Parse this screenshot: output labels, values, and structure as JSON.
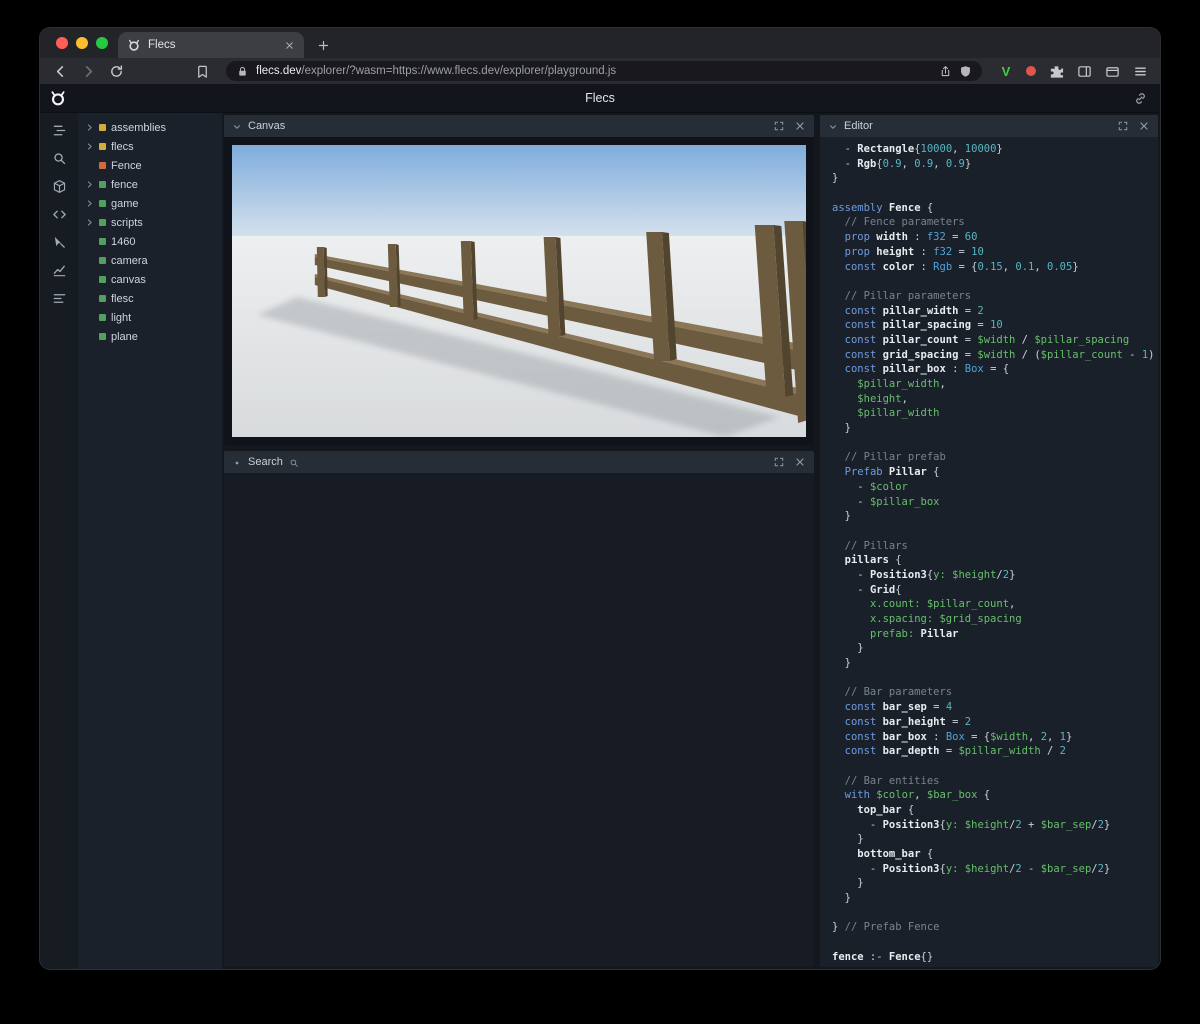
{
  "colors": {
    "traffic_red": "#ff5f57",
    "traffic_yellow": "#febc2e",
    "traffic_green": "#28c840",
    "accent_green_v": "#3dd13d",
    "badge_red": "#e1554a"
  },
  "browser": {
    "tab": {
      "title": "Flecs"
    },
    "toolbar": {
      "url_domain": "flecs.dev",
      "url_rest": "/explorer/?wasm=https://www.flecs.dev/explorer/playground.js",
      "v_badge": "V"
    }
  },
  "app": {
    "header": {
      "title": "Flecs"
    },
    "sidebar_icons": [
      {
        "name": "outliner-icon"
      },
      {
        "name": "search-icon"
      },
      {
        "name": "entities-icon"
      },
      {
        "name": "code-icon"
      },
      {
        "name": "inspect-icon"
      },
      {
        "name": "stats-icon"
      },
      {
        "name": "queries-icon"
      }
    ],
    "tree": {
      "items": [
        {
          "label": "assemblies",
          "color": "#cfae3d",
          "arrow": true
        },
        {
          "label": "flecs",
          "color": "#cfae3d",
          "arrow": true
        },
        {
          "label": "Fence",
          "color": "#d0693b",
          "arrow": false
        },
        {
          "label": "fence",
          "color": "#53a05e",
          "arrow": true
        },
        {
          "label": "game",
          "color": "#53a05e",
          "arrow": true
        },
        {
          "label": "scripts",
          "color": "#53a05e",
          "arrow": true
        },
        {
          "label": "1460",
          "color": "#53a05e",
          "arrow": false
        },
        {
          "label": "camera",
          "color": "#53a05e",
          "arrow": false
        },
        {
          "label": "canvas",
          "color": "#53a05e",
          "arrow": false
        },
        {
          "label": "flesc",
          "color": "#53a05e",
          "arrow": false
        },
        {
          "label": "light",
          "color": "#53a05e",
          "arrow": false
        },
        {
          "label": "plane",
          "color": "#53a05e",
          "arrow": false
        }
      ]
    },
    "panels": {
      "canvas": {
        "title": "Canvas"
      },
      "search": {
        "title": "Search"
      },
      "editor": {
        "title": "Editor"
      }
    }
  },
  "scene": {
    "description": "3D viewport showing a brown wooden fence with pillars and two rails on light ground under a blue sky",
    "sky_top": "#7facdc",
    "sky_bottom": "#d9e4ee",
    "ground_top": "#edeff0",
    "ground_bottom": "#d8dbdd",
    "wood_front": "#6d5b3f",
    "wood_top": "#8b7757",
    "wood_side": "#52452f",
    "shadow": "#9aa0a6"
  },
  "editor": {
    "palette": {
      "p": "#ccd2da",
      "k": "#6e9ce0",
      "t": "#4fa3d8",
      "n": "#56b6c2",
      "v": "#67bf6b",
      "c": "#79828e",
      "d": "#e8ebf0"
    },
    "lines": [
      [
        [
          "p",
          "  - "
        ],
        [
          "d",
          "Rectangle"
        ],
        [
          "p",
          "{"
        ],
        [
          "n",
          "10000"
        ],
        [
          "p",
          ", "
        ],
        [
          "n",
          "10000"
        ],
        [
          "p",
          "}"
        ]
      ],
      [
        [
          "p",
          "  - "
        ],
        [
          "d",
          "Rgb"
        ],
        [
          "p",
          "{"
        ],
        [
          "n",
          "0.9"
        ],
        [
          "p",
          ", "
        ],
        [
          "n",
          "0.9"
        ],
        [
          "p",
          ", "
        ],
        [
          "n",
          "0.9"
        ],
        [
          "p",
          "}"
        ]
      ],
      [
        [
          "p",
          "}"
        ]
      ],
      [],
      [
        [
          "k",
          "assembly"
        ],
        [
          "p",
          " "
        ],
        [
          "d",
          "Fence"
        ],
        [
          "p",
          " {"
        ]
      ],
      [
        [
          "c",
          "  // Fence parameters"
        ]
      ],
      [
        [
          "p",
          "  "
        ],
        [
          "k",
          "prop"
        ],
        [
          "p",
          " "
        ],
        [
          "d",
          "width"
        ],
        [
          "p",
          " : "
        ],
        [
          "t",
          "f32"
        ],
        [
          "p",
          " = "
        ],
        [
          "n",
          "60"
        ]
      ],
      [
        [
          "p",
          "  "
        ],
        [
          "k",
          "prop"
        ],
        [
          "p",
          " "
        ],
        [
          "d",
          "height"
        ],
        [
          "p",
          " : "
        ],
        [
          "t",
          "f32"
        ],
        [
          "p",
          " = "
        ],
        [
          "n",
          "10"
        ]
      ],
      [
        [
          "p",
          "  "
        ],
        [
          "k",
          "const"
        ],
        [
          "p",
          " "
        ],
        [
          "d",
          "color"
        ],
        [
          "p",
          " : "
        ],
        [
          "t",
          "Rgb"
        ],
        [
          "p",
          " = {"
        ],
        [
          "n",
          "0.15"
        ],
        [
          "p",
          ", "
        ],
        [
          "n",
          "0.1"
        ],
        [
          "p",
          ", "
        ],
        [
          "n",
          "0.05"
        ],
        [
          "p",
          "}"
        ]
      ],
      [],
      [
        [
          "c",
          "  // Pillar parameters"
        ]
      ],
      [
        [
          "p",
          "  "
        ],
        [
          "k",
          "const"
        ],
        [
          "p",
          " "
        ],
        [
          "d",
          "pillar_width"
        ],
        [
          "p",
          " = "
        ],
        [
          "n",
          "2"
        ]
      ],
      [
        [
          "p",
          "  "
        ],
        [
          "k",
          "const"
        ],
        [
          "p",
          " "
        ],
        [
          "d",
          "pillar_spacing"
        ],
        [
          "p",
          " = "
        ],
        [
          "n",
          "10"
        ]
      ],
      [
        [
          "p",
          "  "
        ],
        [
          "k",
          "const"
        ],
        [
          "p",
          " "
        ],
        [
          "d",
          "pillar_count"
        ],
        [
          "p",
          " = "
        ],
        [
          "v",
          "$width"
        ],
        [
          "p",
          " / "
        ],
        [
          "v",
          "$pillar_spacing"
        ]
      ],
      [
        [
          "p",
          "  "
        ],
        [
          "k",
          "const"
        ],
        [
          "p",
          " "
        ],
        [
          "d",
          "grid_spacing"
        ],
        [
          "p",
          " = "
        ],
        [
          "v",
          "$width"
        ],
        [
          "p",
          " / ("
        ],
        [
          "v",
          "$pillar_count"
        ],
        [
          "p",
          " - "
        ],
        [
          "n",
          "1"
        ],
        [
          "p",
          ")"
        ]
      ],
      [
        [
          "p",
          "  "
        ],
        [
          "k",
          "const"
        ],
        [
          "p",
          " "
        ],
        [
          "d",
          "pillar_box"
        ],
        [
          "p",
          " : "
        ],
        [
          "t",
          "Box"
        ],
        [
          "p",
          " = {"
        ]
      ],
      [
        [
          "p",
          "    "
        ],
        [
          "v",
          "$pillar_width"
        ],
        [
          "p",
          ","
        ]
      ],
      [
        [
          "p",
          "    "
        ],
        [
          "v",
          "$height"
        ],
        [
          "p",
          ","
        ]
      ],
      [
        [
          "p",
          "    "
        ],
        [
          "v",
          "$pillar_width"
        ]
      ],
      [
        [
          "p",
          "  }"
        ]
      ],
      [],
      [
        [
          "c",
          "  // Pillar prefab"
        ]
      ],
      [
        [
          "p",
          "  "
        ],
        [
          "k",
          "Prefab"
        ],
        [
          "p",
          " "
        ],
        [
          "d",
          "Pillar"
        ],
        [
          "p",
          " {"
        ]
      ],
      [
        [
          "p",
          "    - "
        ],
        [
          "v",
          "$color"
        ]
      ],
      [
        [
          "p",
          "    - "
        ],
        [
          "v",
          "$pillar_box"
        ]
      ],
      [
        [
          "p",
          "  }"
        ]
      ],
      [],
      [
        [
          "c",
          "  // Pillars"
        ]
      ],
      [
        [
          "p",
          "  "
        ],
        [
          "d",
          "pillars"
        ],
        [
          "p",
          " {"
        ]
      ],
      [
        [
          "p",
          "    - "
        ],
        [
          "d",
          "Position3"
        ],
        [
          "p",
          "{"
        ],
        [
          "v",
          "y:"
        ],
        [
          "p",
          " "
        ],
        [
          "v",
          "$height"
        ],
        [
          "p",
          "/"
        ],
        [
          "n",
          "2"
        ],
        [
          "p",
          "}"
        ]
      ],
      [
        [
          "p",
          "    - "
        ],
        [
          "d",
          "Grid"
        ],
        [
          "p",
          "{"
        ]
      ],
      [
        [
          "p",
          "      "
        ],
        [
          "v",
          "x.count:"
        ],
        [
          "p",
          " "
        ],
        [
          "v",
          "$pillar_count"
        ],
        [
          "p",
          ","
        ]
      ],
      [
        [
          "p",
          "      "
        ],
        [
          "v",
          "x.spacing:"
        ],
        [
          "p",
          " "
        ],
        [
          "v",
          "$grid_spacing"
        ]
      ],
      [
        [
          "p",
          "      "
        ],
        [
          "v",
          "prefab:"
        ],
        [
          "p",
          " "
        ],
        [
          "d",
          "Pillar"
        ]
      ],
      [
        [
          "p",
          "    }"
        ]
      ],
      [
        [
          "p",
          "  }"
        ]
      ],
      [],
      [
        [
          "c",
          "  // Bar parameters"
        ]
      ],
      [
        [
          "p",
          "  "
        ],
        [
          "k",
          "const"
        ],
        [
          "p",
          " "
        ],
        [
          "d",
          "bar_sep"
        ],
        [
          "p",
          " = "
        ],
        [
          "n",
          "4"
        ]
      ],
      [
        [
          "p",
          "  "
        ],
        [
          "k",
          "const"
        ],
        [
          "p",
          " "
        ],
        [
          "d",
          "bar_height"
        ],
        [
          "p",
          " = "
        ],
        [
          "n",
          "2"
        ]
      ],
      [
        [
          "p",
          "  "
        ],
        [
          "k",
          "const"
        ],
        [
          "p",
          " "
        ],
        [
          "d",
          "bar_box"
        ],
        [
          "p",
          " : "
        ],
        [
          "t",
          "Box"
        ],
        [
          "p",
          " = {"
        ],
        [
          "v",
          "$width"
        ],
        [
          "p",
          ", "
        ],
        [
          "n",
          "2"
        ],
        [
          "p",
          ", "
        ],
        [
          "n",
          "1"
        ],
        [
          "p",
          "}"
        ]
      ],
      [
        [
          "p",
          "  "
        ],
        [
          "k",
          "const"
        ],
        [
          "p",
          " "
        ],
        [
          "d",
          "bar_depth"
        ],
        [
          "p",
          " = "
        ],
        [
          "v",
          "$pillar_width"
        ],
        [
          "p",
          " / "
        ],
        [
          "n",
          "2"
        ]
      ],
      [],
      [
        [
          "c",
          "  // Bar entities"
        ]
      ],
      [
        [
          "p",
          "  "
        ],
        [
          "k",
          "with"
        ],
        [
          "p",
          " "
        ],
        [
          "v",
          "$color"
        ],
        [
          "p",
          ", "
        ],
        [
          "v",
          "$bar_box"
        ],
        [
          "p",
          " {"
        ]
      ],
      [
        [
          "p",
          "    "
        ],
        [
          "d",
          "top_bar"
        ],
        [
          "p",
          " {"
        ]
      ],
      [
        [
          "p",
          "      - "
        ],
        [
          "d",
          "Position3"
        ],
        [
          "p",
          "{"
        ],
        [
          "v",
          "y:"
        ],
        [
          "p",
          " "
        ],
        [
          "v",
          "$height"
        ],
        [
          "p",
          "/"
        ],
        [
          "n",
          "2"
        ],
        [
          "p",
          " + "
        ],
        [
          "v",
          "$bar_sep"
        ],
        [
          "p",
          "/"
        ],
        [
          "n",
          "2"
        ],
        [
          "p",
          "}"
        ]
      ],
      [
        [
          "p",
          "    }"
        ]
      ],
      [
        [
          "p",
          "    "
        ],
        [
          "d",
          "bottom_bar"
        ],
        [
          "p",
          " {"
        ]
      ],
      [
        [
          "p",
          "      - "
        ],
        [
          "d",
          "Position3"
        ],
        [
          "p",
          "{"
        ],
        [
          "v",
          "y:"
        ],
        [
          "p",
          " "
        ],
        [
          "v",
          "$height"
        ],
        [
          "p",
          "/"
        ],
        [
          "n",
          "2"
        ],
        [
          "p",
          " - "
        ],
        [
          "v",
          "$bar_sep"
        ],
        [
          "p",
          "/"
        ],
        [
          "n",
          "2"
        ],
        [
          "p",
          "}"
        ]
      ],
      [
        [
          "p",
          "    }"
        ]
      ],
      [
        [
          "p",
          "  }"
        ]
      ],
      [],
      [
        [
          "p",
          "} "
        ],
        [
          "c",
          "// Prefab Fence"
        ]
      ],
      [],
      [
        [
          "d",
          "fence"
        ],
        [
          "p",
          " :- "
        ],
        [
          "d",
          "Fence"
        ],
        [
          "p",
          "{}"
        ]
      ]
    ]
  }
}
